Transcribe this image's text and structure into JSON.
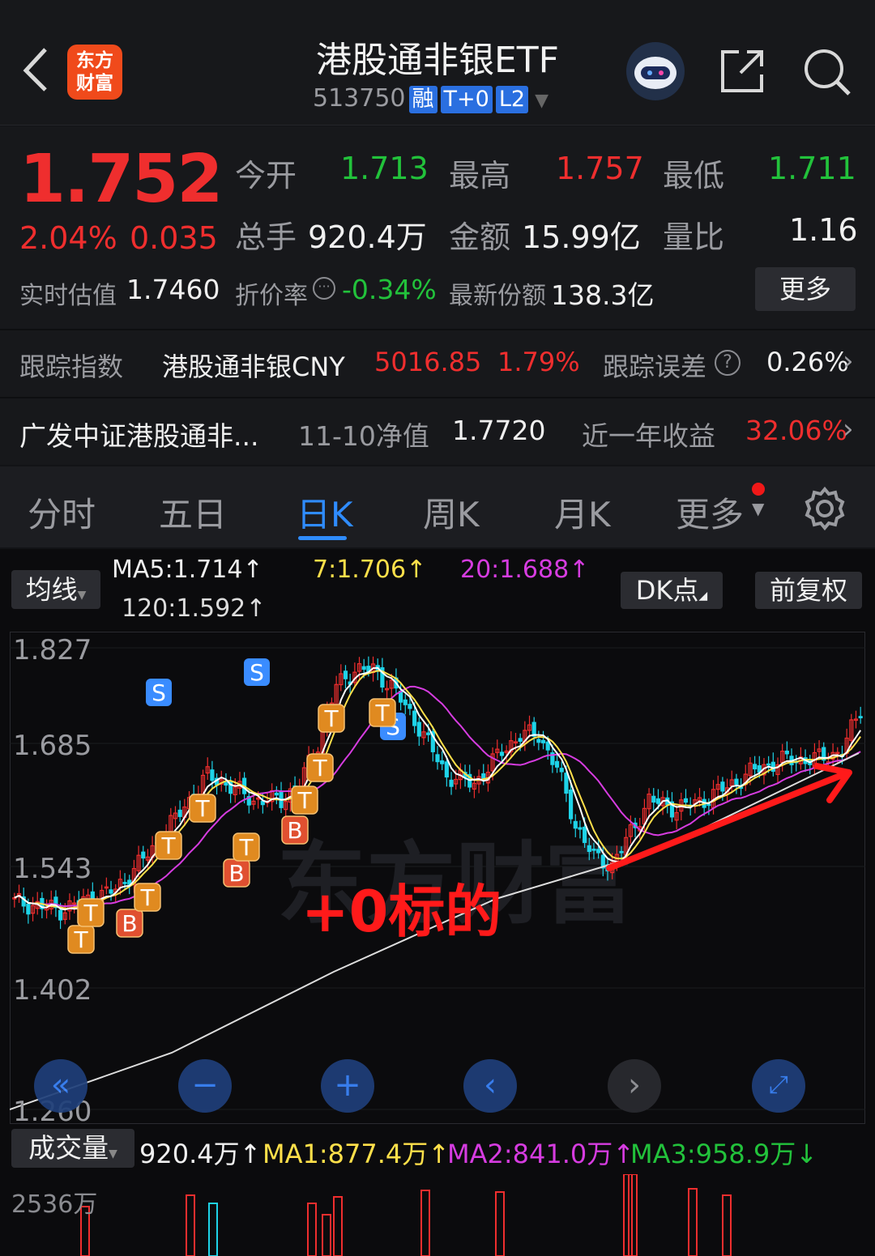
{
  "header": {
    "title": "港股通非银ETF",
    "code": "513750",
    "tags": [
      "融",
      "T+0",
      "L2"
    ],
    "logo_line1": "东方",
    "logo_line2": "财富"
  },
  "quote": {
    "price": "1.752",
    "change_pct": "2.04%",
    "change_amt": "0.035",
    "open_label": "今开",
    "open": "1.713",
    "high_label": "最高",
    "high": "1.757",
    "low_label": "最低",
    "low": "1.711",
    "vol_label": "总手",
    "vol": "920.4万",
    "amt_label": "金额",
    "amt": "15.99亿",
    "ratio_label": "量比",
    "ratio": "1.16",
    "iopv_label": "实时估值",
    "iopv": "1.7460",
    "premium_label": "折价率",
    "premium": "-0.34%",
    "shares_label": "最新份额",
    "shares": "138.3亿",
    "more": "更多"
  },
  "track": {
    "label": "跟踪指数",
    "index": "港股通非银CNY",
    "value": "5016.85",
    "pct": "1.79%",
    "err_label": "跟踪误差",
    "err": "0.26%"
  },
  "fund": {
    "name": "广发中证港股通非...",
    "nav_label": "11-10净值",
    "nav": "1.7720",
    "ret_label": "近一年收益",
    "ret": "32.06%"
  },
  "tabs": [
    "分时",
    "五日",
    "日K",
    "周K",
    "月K",
    "更多"
  ],
  "indicator": {
    "type": "均线",
    "ma5": "MA5:1.714↑",
    "ma7": "7:1.706↑",
    "ma20": "20:1.688↑",
    "ma120": "120:1.592↑",
    "dk": "DK点",
    "fq": "前复权"
  },
  "axis": {
    "y": [
      "1.827",
      "1.685",
      "1.543",
      "1.402",
      "1.260"
    ]
  },
  "annotation": "+0标的",
  "watermark": "东方财富",
  "volume": {
    "label": "成交量",
    "vol": "920.4万↑",
    "ma1": "MA1:877.4万↑",
    "ma2": "MA2:841.0万↑",
    "ma3": "MA3:958.9万↓",
    "max": "2536万"
  },
  "colors": {
    "up": "#ef2e2e",
    "down": "#1ed3e8",
    "ma5": "#ffffff",
    "ma7": "#ffe04a",
    "ma20": "#d63ce0",
    "ma120": "#dddddd",
    "accent": "#2f8cff"
  }
}
